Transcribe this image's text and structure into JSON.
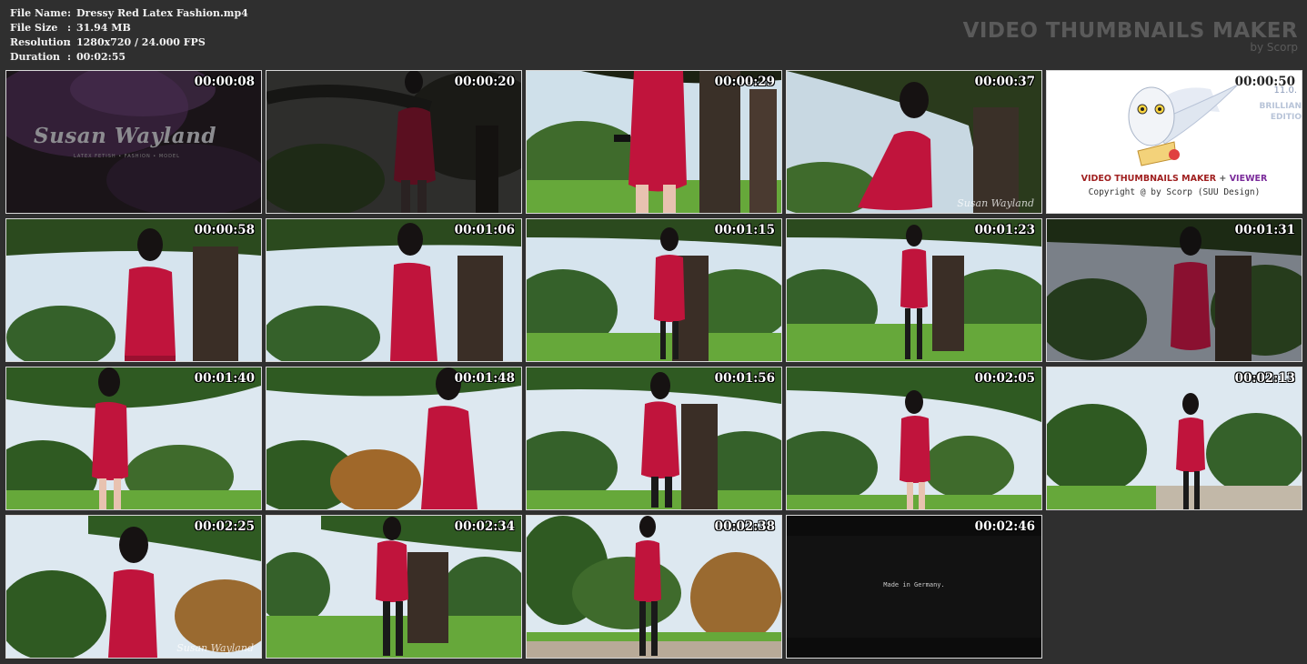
{
  "file_info": {
    "rows": [
      {
        "label": "File Name",
        "value": "Dressy Red Latex Fashion.mp4"
      },
      {
        "label": "File Size",
        "value": "31.94 MB"
      },
      {
        "label": "Resolution",
        "value": "1280x720 / 24.000 FPS"
      },
      {
        "label": "Duration",
        "value": "00:02:55"
      }
    ]
  },
  "brand": {
    "title": "VIDEO THUMBNAILS MAKER",
    "subtitle": "by Scorp"
  },
  "thumbnails": [
    {
      "time": "00:00:08"
    },
    {
      "time": "00:00:20"
    },
    {
      "time": "00:00:29"
    },
    {
      "time": "00:00:37",
      "watermark": "Susan Wayland"
    },
    {
      "time": "00:00:50"
    },
    {
      "time": "00:00:58"
    },
    {
      "time": "00:01:06"
    },
    {
      "time": "00:01:15"
    },
    {
      "time": "00:01:23"
    },
    {
      "time": "00:01:31"
    },
    {
      "time": "00:01:40"
    },
    {
      "time": "00:01:48"
    },
    {
      "time": "00:01:56"
    },
    {
      "time": "00:02:05"
    },
    {
      "time": "00:02:13"
    },
    {
      "time": "00:02:25",
      "watermark": "Susan Wayland"
    },
    {
      "time": "00:02:34"
    },
    {
      "time": "00:02:38"
    },
    {
      "time": "00:02:46",
      "caption": "Made in Germany."
    }
  ],
  "intro_logo": {
    "text": "Susan Wayland",
    "tagline": "LATEX FETISH • FASHION • MODEL"
  },
  "vtm_promo": {
    "title_main": "VIDEO THUMBNAILS MAKER",
    "title_plus": "+",
    "title_viewer": "VIEWER",
    "copyright": "Copyright @ by Scorp (SUU Design)",
    "version": "11.0.",
    "edition_1": "BRILLIAN",
    "edition_2": "EDITIO"
  },
  "colors": {
    "background": "#2f2f2f",
    "dress": "#c0143c",
    "grass": "#5aa02c",
    "foliage": "#2f5a22"
  }
}
